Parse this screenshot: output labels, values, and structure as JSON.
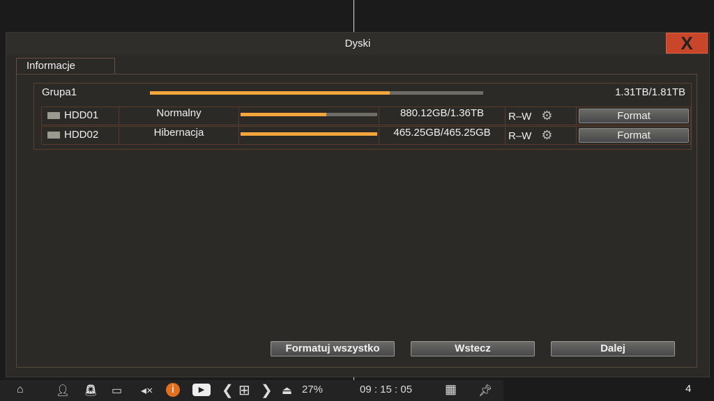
{
  "dialog": {
    "title": "Dyski",
    "close_label": "X"
  },
  "tabs": [
    {
      "label": "Informacje"
    }
  ],
  "group": {
    "name": "Grupa1",
    "usage": "1.31TB/1.81TB",
    "fill_fraction": 0.72
  },
  "disks": [
    {
      "name": "HDD01",
      "status": "Normalny",
      "capacity": "880.12GB/1.36TB",
      "mode": "R–W",
      "fill_fraction": 0.63,
      "format_label": "Format"
    },
    {
      "name": "HDD02",
      "status": "Hibernacja",
      "capacity": "465.25GB/465.25GB",
      "mode": "R–W",
      "fill_fraction": 1.0,
      "format_label": "Format"
    }
  ],
  "buttons": {
    "format_all": "Formatuj  wszystko",
    "back": "Wstecz",
    "next": "Dalej"
  },
  "taskbar": {
    "hdd_percent": "27%",
    "time": "09 : 15 : 05",
    "channel": "4"
  },
  "colors": {
    "accent": "#f4a53c",
    "close": "#c9462b"
  }
}
